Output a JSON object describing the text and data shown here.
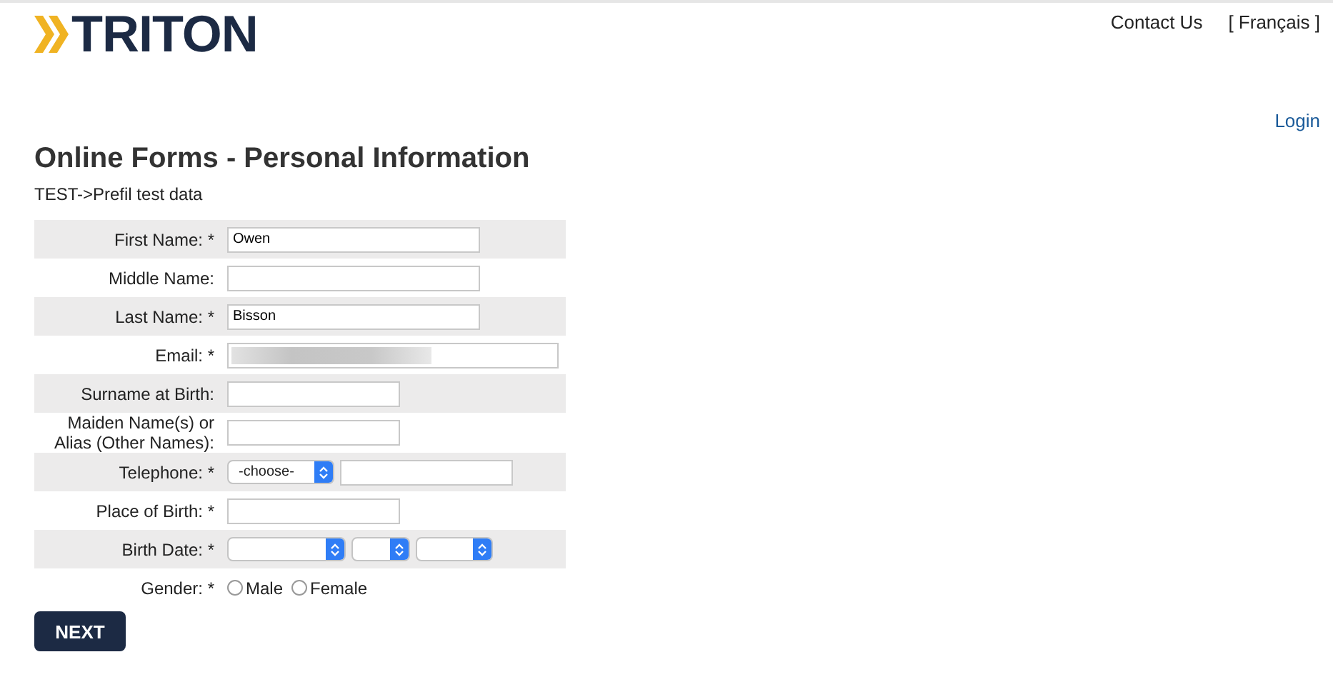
{
  "header": {
    "logo": "TRITON",
    "links": [
      "Contact Us",
      "[ Français ]"
    ],
    "login": "Login"
  },
  "page": {
    "title": "Online Forms - Personal Information",
    "subtitle": "TEST->Prefil test data"
  },
  "form": {
    "rows": [
      {
        "label": "First Name: *",
        "kind": "long",
        "value": "Owen"
      },
      {
        "label": "Middle Name:",
        "kind": "long",
        "value": ""
      },
      {
        "label": "Last Name: *",
        "kind": "long",
        "value": "Bisson"
      },
      {
        "label": "Email: *",
        "kind": "redacted"
      },
      {
        "label": "Surname at Birth:",
        "kind": "short",
        "value": ""
      },
      {
        "label": "Maiden Name(s) or Alias (Other Names):",
        "kind": "short",
        "value": ""
      },
      {
        "label": "Telephone: *",
        "kind": "phone",
        "select": "-choose-"
      },
      {
        "label": "Place of Birth: *",
        "kind": "short",
        "value": ""
      },
      {
        "label": "Birth Date: *",
        "kind": "date"
      },
      {
        "label": "Gender: *",
        "kind": "gender",
        "options": [
          {
            "label": "Male",
            "selected": false
          },
          {
            "label": "Female",
            "selected": false
          }
        ]
      }
    ],
    "button": "NEXT"
  }
}
